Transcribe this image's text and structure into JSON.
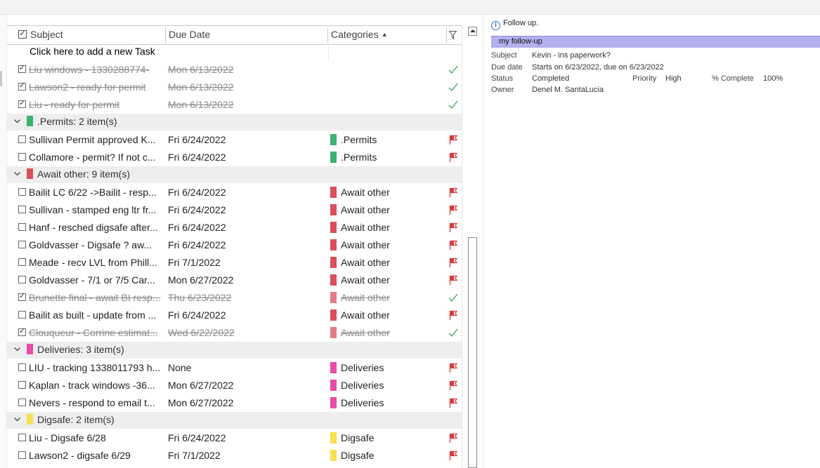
{
  "columns": {
    "subject": "Subject",
    "due_date": "Due Date",
    "categories": "Categories",
    "sort_arrow": "▲"
  },
  "add_task": "Click here to add a new Task",
  "completed_rows": [
    {
      "subject": "Liu windows - 1330288774-",
      "due": "Mon 6/13/2022",
      "category": "",
      "status": "check"
    },
    {
      "subject": "Lawson2 - ready for permit",
      "due": "Mon 6/13/2022",
      "category": "",
      "status": "check"
    },
    {
      "subject": "Liu - ready for permit",
      "due": "Mon 6/13/2022",
      "category": "",
      "status": "check"
    }
  ],
  "groups": [
    {
      "label": ".Permits: 2 item(s)",
      "color": "#3cb371",
      "rows": [
        {
          "subject": "Sullivan Permit approved K...",
          "due": "Fri 6/24/2022",
          "category": ".Permits",
          "status": "flag"
        },
        {
          "subject": "Collamore - permit?  If not c...",
          "due": "Fri 6/24/2022",
          "category": ".Permits",
          "status": "flag"
        }
      ]
    },
    {
      "label": "Await other: 9 item(s)",
      "color": "#d94f5c",
      "rows": [
        {
          "subject": "Bailit LC 6/22 ->Bailit - resp...",
          "due": "Fri 6/24/2022",
          "category": "Await other",
          "status": "flag"
        },
        {
          "subject": "Sullivan - stamped eng ltr fr...",
          "due": "Fri 6/24/2022",
          "category": "Await other",
          "status": "flag"
        },
        {
          "subject": "Hanf - resched digsafe after...",
          "due": "Fri 6/24/2022",
          "category": "Await other",
          "status": "flag"
        },
        {
          "subject": "Goldvasser - Digsafe ?  aw...",
          "due": "Fri 6/24/2022",
          "category": "Await other",
          "status": "flag"
        },
        {
          "subject": "Meade - recv LVL from Phill...",
          "due": "Fri 7/1/2022",
          "category": "Await other",
          "status": "flag"
        },
        {
          "subject": "Goldvasser - 7/1 or 7/5 Car...",
          "due": "Mon 6/27/2022",
          "category": "Await other",
          "status": "flag"
        },
        {
          "subject": "Brunette final - await BI resp...",
          "due": "Thu 6/23/2022",
          "category": "Await other",
          "status": "check"
        },
        {
          "subject": "Bailit as built - update from ...",
          "due": "Fri 6/24/2022",
          "category": "Await other",
          "status": "flag"
        },
        {
          "subject": "Clouqueur - Corrine estimat...",
          "due": "Wed 6/22/2022",
          "category": "Await other",
          "status": "check"
        }
      ]
    },
    {
      "label": "Deliveries: 3 item(s)",
      "color": "#e84ca6",
      "rows": [
        {
          "subject": "LIU - tracking 1338011793 h...",
          "due": "None",
          "category": "Deliveries",
          "status": "flag"
        },
        {
          "subject": "Kaplan - track windows -36...",
          "due": "Mon 6/27/2022",
          "category": "Deliveries",
          "status": "flag"
        },
        {
          "subject": "Nevers - respond to email t...",
          "due": "Mon 6/27/2022",
          "category": "Deliveries",
          "status": "flag"
        }
      ]
    },
    {
      "label": "Digsafe: 2 item(s)",
      "color": "#f5e050",
      "rows": [
        {
          "subject": "Liu - Digsafe 6/28",
          "due": "Fri 6/24/2022",
          "category": "Digsafe",
          "status": "flag"
        },
        {
          "subject": "Lawson2 - digsafe 6/29",
          "due": "Fri 7/1/2022",
          "category": "Digsafe",
          "status": "flag"
        }
      ]
    }
  ],
  "reading_pane": {
    "info_text": "Follow up.",
    "flag_bar": "my follow-up",
    "subject_label": "Subject",
    "subject_value": "Kevin - ins paperwork?",
    "due_label": "Due date",
    "due_value": "Starts on 6/23/2022, due on 6/23/2022",
    "status_label": "Status",
    "status_value": "Completed",
    "priority_label": "Priority",
    "priority_value": "High",
    "complete_label": "% Complete",
    "complete_value": "100%",
    "owner_label": "Owner",
    "owner_value": "Denel M. SantaLucia"
  },
  "colors": {
    "check": "#3ea860",
    "flag": "#d83b3b",
    "group_bg": "#eeeeee",
    "flag_bar": "#b3b0ee"
  }
}
